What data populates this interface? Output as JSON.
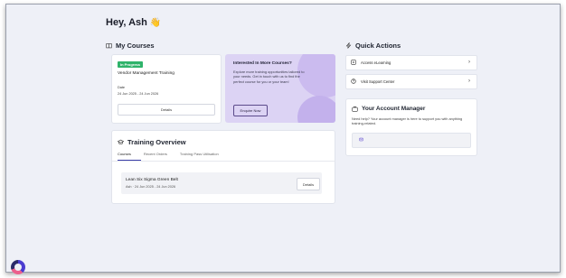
{
  "greeting": {
    "text": "Hey, Ash",
    "emoji": "👋"
  },
  "my_courses": {
    "title": "My Courses",
    "course": {
      "status": "In Progress",
      "name": "Vendor Management Training",
      "date_label": "Date",
      "date_value": "24 Jun 2025 - 24 Jun 2026",
      "details_label": "Details"
    },
    "promo": {
      "title": "Interested In More Courses?",
      "text": "Explore more training opportunities tailored to your needs. Get in touch with us to find the perfect course for you or your team!",
      "button_label": "Enquire Now"
    }
  },
  "training_overview": {
    "title": "Training Overview",
    "tabs": [
      {
        "label": "Courses",
        "active": true
      },
      {
        "label": "Recent Orders",
        "active": false
      },
      {
        "label": "Training Pass Utilisation",
        "active": false
      }
    ],
    "rows": [
      {
        "title": "Lean Six Sigma Green Belt",
        "meta": "Ash  ·  24 Jun 2025 - 24 Jun 2026",
        "button": "Details"
      }
    ]
  },
  "quick_actions": {
    "title": "Quick Actions",
    "items": [
      {
        "label": "Access eLearning",
        "icon": "play-square-icon"
      },
      {
        "label": "Visit Support Center",
        "icon": "help-circle-icon"
      }
    ]
  },
  "account_manager": {
    "title": "Your Account Manager",
    "text": "Need help? Your account manager is here to support you with anything training-related."
  },
  "colors": {
    "accent": "#3b3ea8",
    "status_green": "#2fb36a",
    "promo_bg": "#dcd3f4"
  }
}
